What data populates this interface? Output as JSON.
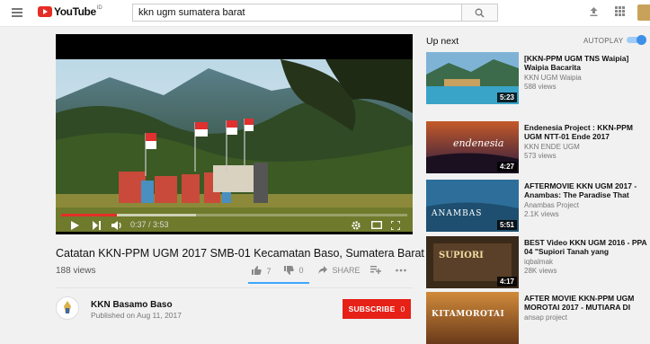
{
  "header": {
    "logo_text": "YouTube",
    "logo_suffix": "ID",
    "search_value": "kkn ugm sumatera barat"
  },
  "player": {
    "timecode": "0:37 / 3:53",
    "progress_fraction": 0.16
  },
  "video": {
    "title": "Catatan KKN-PPM UGM 2017 SMB-01 Kecamatan Baso, Sumatera Barat",
    "views": "188 views",
    "likes": "7",
    "dislikes": "0",
    "share_label": "SHARE"
  },
  "channel": {
    "name": "KKN Basamo Baso",
    "published": "Published on Aug 11, 2017",
    "subscribe_label": "SUBSCRIBE",
    "subscriber_count": "0"
  },
  "sidebar": {
    "up_next_label": "Up next",
    "autoplay_label": "AUTOPLAY",
    "autoplay_on": true,
    "recommendations": [
      {
        "title": "[KKN-PPM UGM TNS Waipia] Waipia Bacarita",
        "channel": "KKN UGM Waipia",
        "views": "588 views",
        "duration": "5:23",
        "thumb_text": ""
      },
      {
        "title": "Endenesia Project : KKN-PPM UGM NTT-01 Ende 2017",
        "channel": "KKN ENDE UGM",
        "views": "573 views",
        "duration": "4:27",
        "thumb_text": "endenesia"
      },
      {
        "title": "AFTERMOVIE KKN UGM 2017 - Anambas: The Paradise That",
        "channel": "Anambas Project",
        "views": "2.1K views",
        "duration": "5:51",
        "thumb_text": "ANAMBAS"
      },
      {
        "title": "BEST Video KKN UGM 2016 - PPA 04 \"Supiori Tanah yang",
        "channel": "iqbalmak",
        "views": "28K views",
        "duration": "4:17",
        "thumb_text": "SUPIORI"
      },
      {
        "title": "AFTER MOVIE KKN-PPM UGM MOROTAI 2017 - MUTIARA DI",
        "channel": "ansap project",
        "views": "",
        "duration": "",
        "thumb_text": "KITAMOROTAI"
      }
    ]
  },
  "colors": {
    "brand_red": "#e52d27",
    "subscribe_red": "#e62117",
    "link_blue": "#3ea6ff",
    "page_bg": "#f1f1f1"
  }
}
